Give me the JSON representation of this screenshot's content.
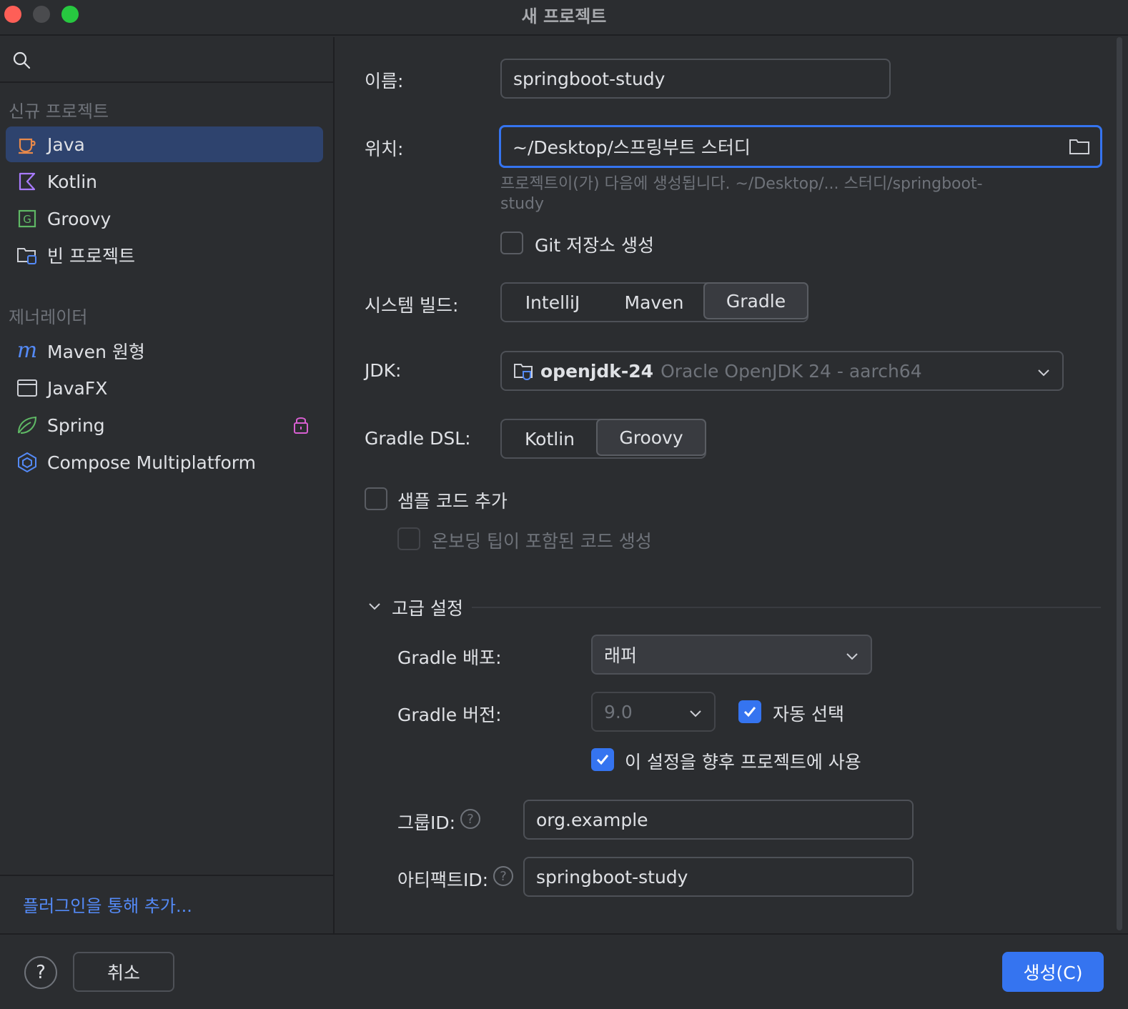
{
  "window": {
    "title": "새 프로젝트"
  },
  "sidebar": {
    "new_project_header": "신규 프로젝트",
    "items": [
      {
        "label": "Java",
        "icon": "java-cup-icon",
        "selected": true
      },
      {
        "label": "Kotlin",
        "icon": "kotlin-icon"
      },
      {
        "label": "Groovy",
        "icon": "groovy-icon"
      },
      {
        "label": "빈 프로젝트",
        "icon": "empty-project-folder-icon"
      }
    ],
    "generators_header": "제너레이터",
    "generators": [
      {
        "label": "Maven 원형",
        "icon": "maven-icon"
      },
      {
        "label": "JavaFX",
        "icon": "javafx-window-icon"
      },
      {
        "label": "Spring",
        "icon": "spring-leaf-icon",
        "locked": true
      },
      {
        "label": "Compose Multiplatform",
        "icon": "compose-icon"
      }
    ],
    "plugin_link": "플러그인을 통해 추가..."
  },
  "form": {
    "name_label": "이름:",
    "name_value": "springboot-study",
    "location_label": "위치:",
    "location_value": "~/Desktop/스프링부트 스터디",
    "location_hint_line1": "프로젝트이(가) 다음에 생성됩니다. ~/Desktop/... 스터디/springboot-",
    "location_hint_line2": "study",
    "git_label": "Git 저장소 생성",
    "build_label": "시스템 빌드:",
    "build_options": [
      "IntelliJ",
      "Maven",
      "Gradle"
    ],
    "build_selected": "Gradle",
    "jdk_label": "JDK:",
    "jdk_name": "openjdk-24",
    "jdk_desc": "Oracle OpenJDK 24 - aarch64",
    "dsl_label": "Gradle DSL:",
    "dsl_options": [
      "Kotlin",
      "Groovy"
    ],
    "dsl_selected": "Groovy",
    "sample_code_label": "샘플 코드 추가",
    "onboarding_label": "온보딩 팁이 포함된 코드 생성",
    "advanced_label": "고급 설정",
    "gradle_dist_label": "Gradle 배포:",
    "gradle_dist_value": "래퍼",
    "gradle_version_label": "Gradle 버전:",
    "gradle_version_value": "9.0",
    "auto_select_label": "자동 선택",
    "auto_select_checked": true,
    "use_future_label": "이 설정을 향후 프로젝트에 사용",
    "use_future_checked": true,
    "group_id_label": "그룹ID:",
    "group_id_value": "org.example",
    "artifact_id_label": "아티팩트ID:",
    "artifact_id_value": "springboot-study"
  },
  "footer": {
    "help": "?",
    "cancel": "취소",
    "create": "생성(C)"
  },
  "colors": {
    "accent": "#3574f0",
    "link": "#548af7",
    "selection": "#2e436e",
    "background": "#2b2d30"
  }
}
